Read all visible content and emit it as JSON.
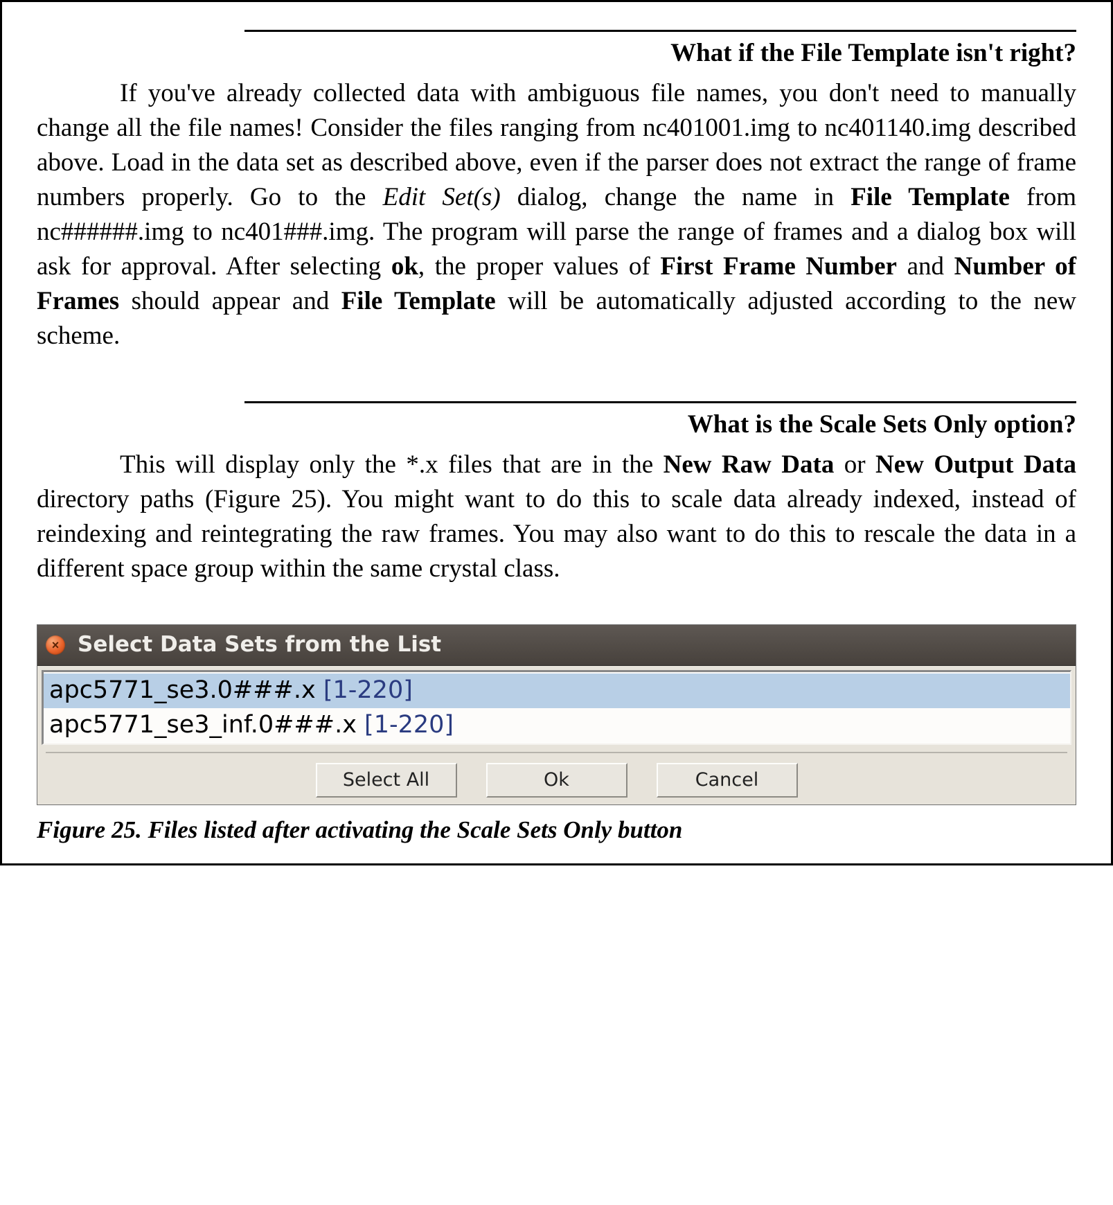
{
  "section1": {
    "heading": "What if the File Template isn't right?",
    "p1a": "If you've already collected data with ambiguous file names, you don't need to manually change all the file names! Consider the files ranging from nc401001.img to nc401140.img described above. Load in the data set as described above, even if the parser does not extract the range of frame numbers properly. Go to the ",
    "p1b_italic": "Edit Set(s)",
    "p1c": " dialog, change the name in ",
    "p1d_bold": "File Template",
    "p1e": " from nc######.img to nc401###.img. The program will parse the range of frames and a dialog box will ask for approval. After selecting ",
    "p1f_bold": "ok",
    "p1g": ", the proper values of ",
    "p1h_bold": "First Frame Number",
    "p1i": " and ",
    "p1j_bold": "Number of Frames",
    "p1k": " should appear and ",
    "p1l_bold": "File Template",
    "p1m": " will be automatically adjusted according to the new scheme."
  },
  "section2": {
    "heading": "What is the Scale Sets Only option?",
    "p2a": "This will display only the *.x files that are in the ",
    "p2b_bold": "New Raw Data",
    "p2c": " or ",
    "p2d_bold": "New Output Data",
    "p2e": " directory paths (Figure 25). You might want to do this to scale data already indexed, instead of reindexing and reintegrating the raw frames. You may also want to do this to rescale the data in a different space group within the same crystal class."
  },
  "dialog": {
    "title": "Select Data Sets from the List",
    "rows": [
      {
        "name": "apc5771_se3.0###.x ",
        "range": "[1-220]",
        "selected": true
      },
      {
        "name": "apc5771_se3_inf.0###.x ",
        "range": "[1-220]",
        "selected": false
      }
    ],
    "buttons": {
      "select_all": "Select All",
      "ok": "Ok",
      "cancel": "Cancel"
    }
  },
  "caption": "Figure 25. Files listed after activating the Scale Sets Only button"
}
